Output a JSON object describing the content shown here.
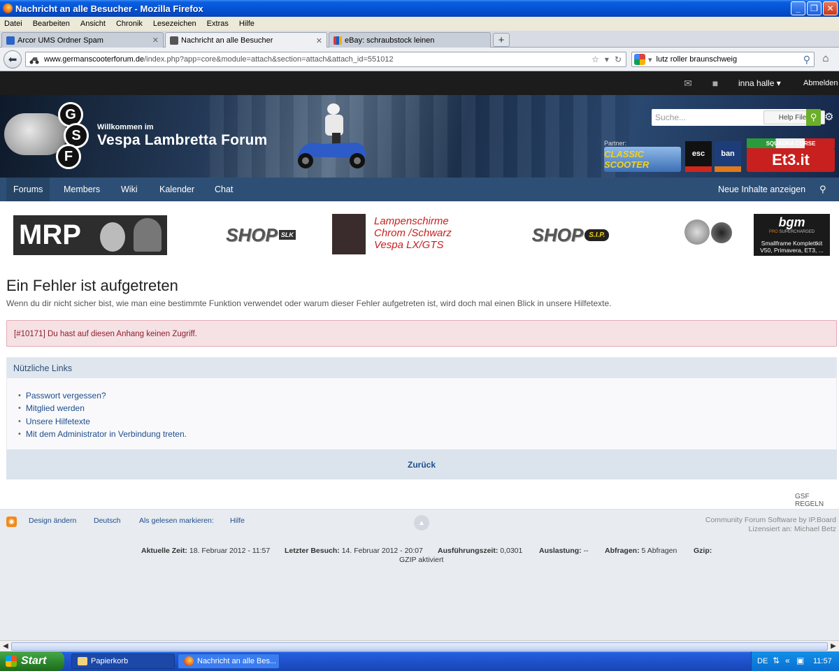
{
  "window": {
    "title": "Nachricht an alle Besucher - Mozilla Firefox"
  },
  "menu": [
    "Datei",
    "Bearbeiten",
    "Ansicht",
    "Chronik",
    "Lesezeichen",
    "Extras",
    "Hilfe"
  ],
  "tabs": [
    {
      "label": "Arcor UMS Ordner Spam",
      "active": false
    },
    {
      "label": "Nachricht an alle Besucher",
      "active": true
    },
    {
      "label": "eBay: schraubstock leinen",
      "active": false
    }
  ],
  "address": {
    "domain": "www.germanscooterforum.de",
    "path": "/index.php?app=core&module=attach&section=attach&attach_id=551012"
  },
  "searchbar": {
    "value": "lutz roller braunschweig"
  },
  "userbar": {
    "username": "inna halle",
    "logout": "Abmelden"
  },
  "header": {
    "logo_letters": [
      "G",
      "S",
      "F"
    ],
    "welcome": "Willkommen im",
    "forum_title": "Vespa Lambretta Forum",
    "search_placeholder": "Suche...",
    "search_scope": "Help Files",
    "partner_label": "Partner:",
    "partner_logos": [
      "CLASSIC SCOOTER",
      "esc",
      "ban",
      "SQUADRA CORSE",
      "Et3.it"
    ]
  },
  "nav": {
    "items": [
      "Forums",
      "Members",
      "Wiki",
      "Kalender",
      "Chat"
    ],
    "new_content": "Neue Inhalte anzeigen"
  },
  "ads": {
    "mrp": "MRP",
    "shop1": "SHOP",
    "shop1_tag": "SLK",
    "lamp": [
      "Lampenschirme",
      "Chrom /Schwarz",
      "Vespa LX/GTS"
    ],
    "shop2": "SHOP",
    "shop2_tag": "S.I.P.",
    "bgm": "bgm",
    "bgm_sub": [
      "PRO",
      "SUPERCHARGED"
    ],
    "bgm_text": [
      "Smallframe Komplettkit",
      "V50, Primavera, ET3, ..."
    ]
  },
  "error": {
    "title": "Ein Fehler ist aufgetreten",
    "description": "Wenn du dir nicht sicher bist, wie man eine bestimmte Funktion verwendet oder warum dieser Fehler aufgetreten ist, wird doch mal einen Blick in unsere Hilfetexte.",
    "message": "[#10171] Du hast auf diesen Anhang keinen Zugriff."
  },
  "useful_links": {
    "heading": "Nützliche Links",
    "items": [
      "Passwort vergessen?",
      "Mitglied werden",
      "Unsere Hilfetexte",
      "Mit dem Administrator in Verbindung treten."
    ],
    "back": "Zurück"
  },
  "rules": "GSF REGELN",
  "footer": {
    "links": [
      "Design ändern",
      "Deutsch",
      "Als gelesen markieren:",
      "Hilfe"
    ],
    "copyright": [
      "Community Forum Software by IP.Board",
      "Lizensiert an: Michael Betz"
    ],
    "stats": [
      {
        "label": "Aktuelle Zeit:",
        "value": "18. Februar 2012 - 11:57"
      },
      {
        "label": "Letzter Besuch:",
        "value": "14. Februar 2012 - 20:07"
      },
      {
        "label": "Ausführungszeit:",
        "value": "0,0301"
      },
      {
        "label": "Auslastung:",
        "value": "--"
      },
      {
        "label": "Abfragen:",
        "value": "5 Abfragen"
      },
      {
        "label": "Gzip:",
        "value": ""
      }
    ],
    "gzip_note": "GZIP aktiviert"
  },
  "taskbar": {
    "start": "Start",
    "items": [
      "Papierkorb",
      "Nachricht an alle Bes..."
    ],
    "lang": "DE",
    "clock": "11:57"
  }
}
